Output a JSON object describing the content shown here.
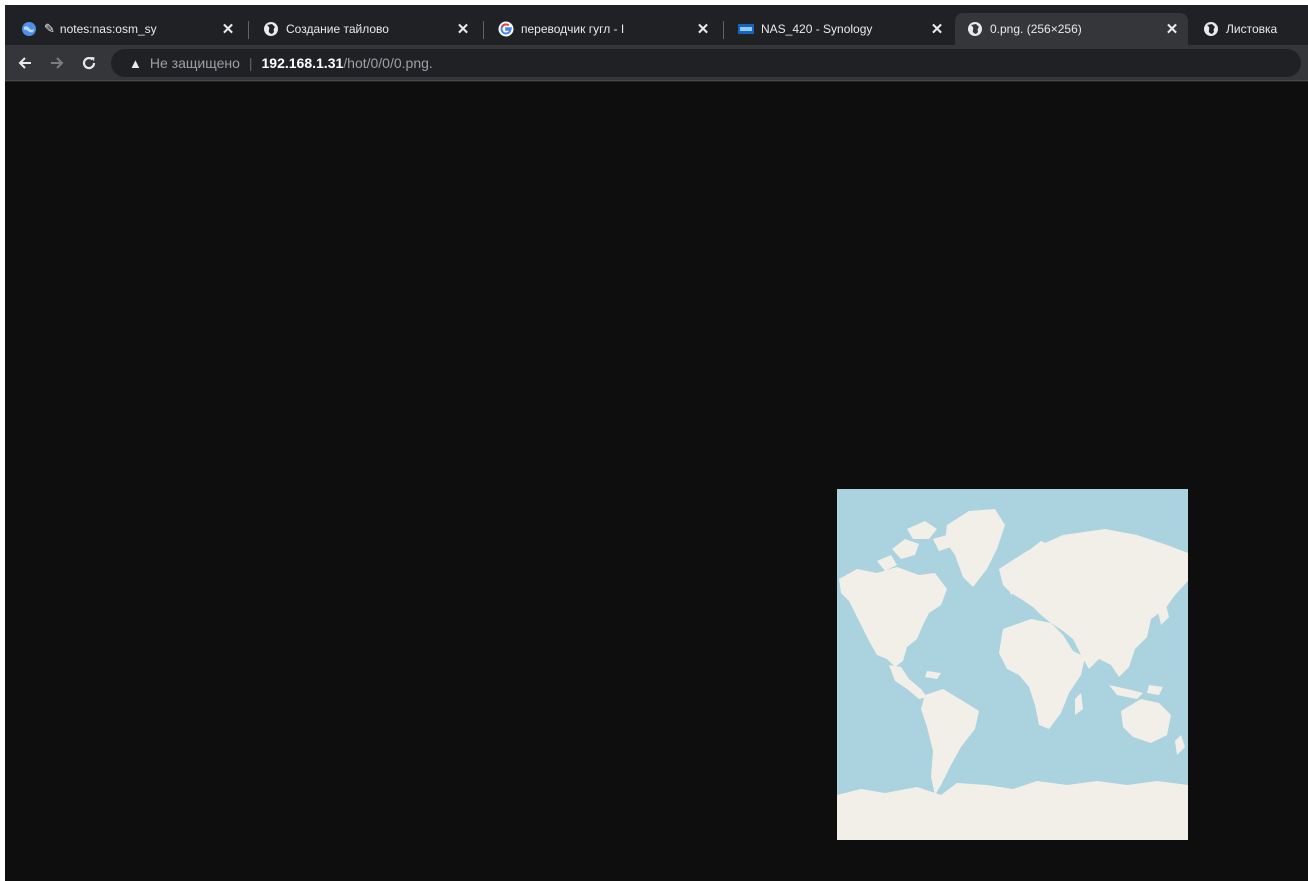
{
  "tabs": [
    {
      "title": "notes:nas:osm_sy",
      "icon": "globe-edit-icon",
      "active": false
    },
    {
      "title": "Создание тайлово",
      "icon": "globe-icon",
      "active": false
    },
    {
      "title": "переводчик гугл - I",
      "icon": "google-icon",
      "active": false
    },
    {
      "title": "NAS_420 - Synology",
      "icon": "dsm-icon",
      "active": false
    },
    {
      "title": "0.png. (256×256)",
      "icon": "globe-icon",
      "active": true
    },
    {
      "title": "Листовка",
      "icon": "globe-icon",
      "active": false
    }
  ],
  "address_bar": {
    "security_label": "Не защищено",
    "host": "192.168.1.31",
    "path": "/hot/0/0/0.png."
  },
  "colors": {
    "page_background": "#0e0e0e",
    "ocean": "#aad3df",
    "land": "#f2efe9",
    "tab_strip": "#202124",
    "toolbar": "#35363a"
  },
  "image": {
    "name": "world-map-tile",
    "natural_size": "256×256"
  }
}
